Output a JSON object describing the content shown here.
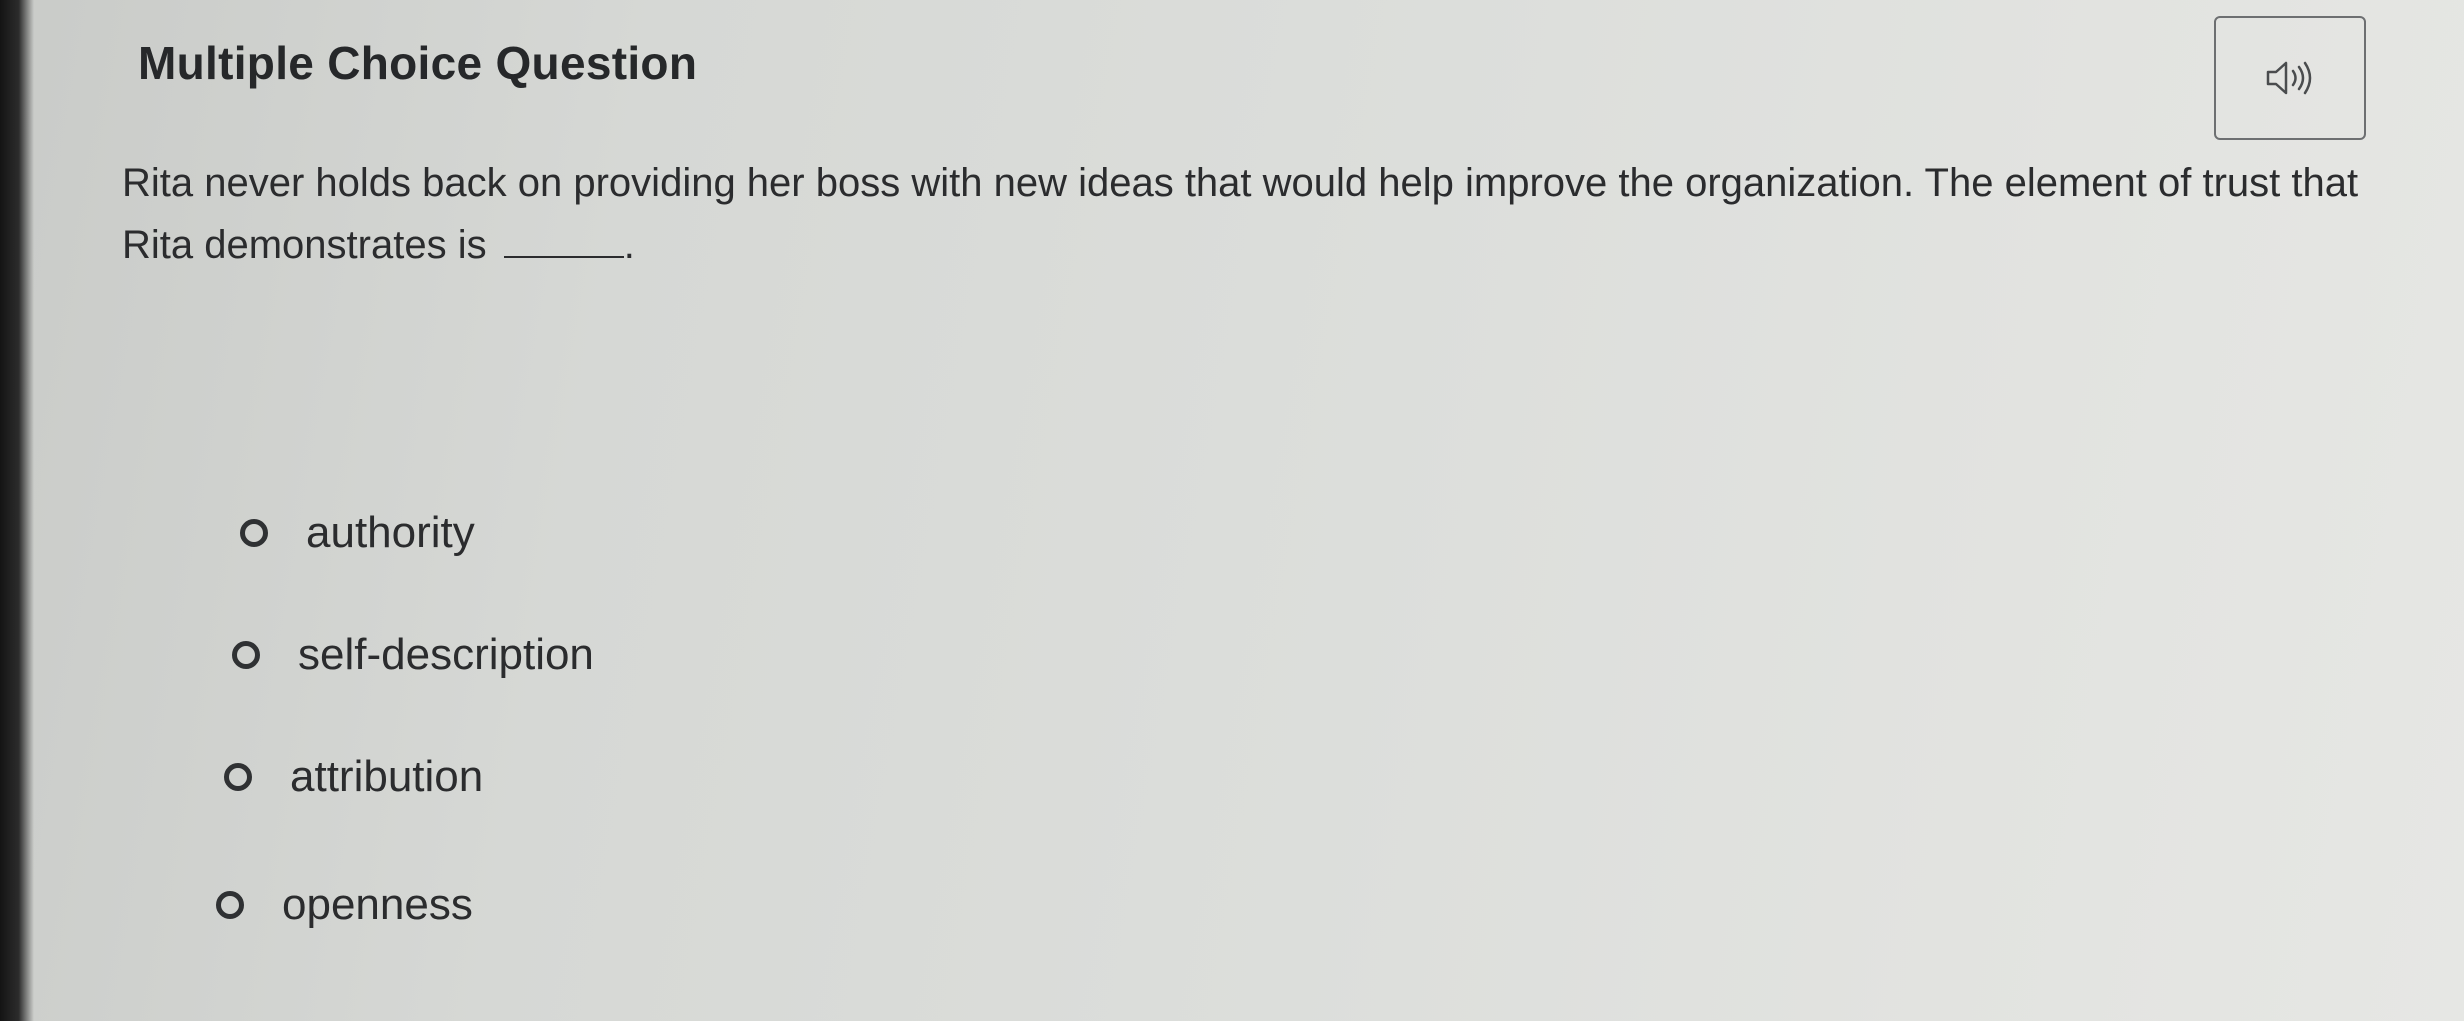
{
  "question": {
    "heading": "Multiple Choice Question",
    "prompt_before_blank": "Rita never holds back on providing her boss with new ideas that would help improve the organization. The element of trust that Rita demonstrates is",
    "prompt_after_blank": "."
  },
  "audio": {
    "icon": "speaker-icon"
  },
  "choices": [
    {
      "label": "authority",
      "selected": false
    },
    {
      "label": "self-description",
      "selected": false
    },
    {
      "label": "attribution",
      "selected": false
    },
    {
      "label": "openness",
      "selected": false
    }
  ],
  "colors": {
    "text": "#2b2c2e",
    "border": "#6d6f71"
  }
}
